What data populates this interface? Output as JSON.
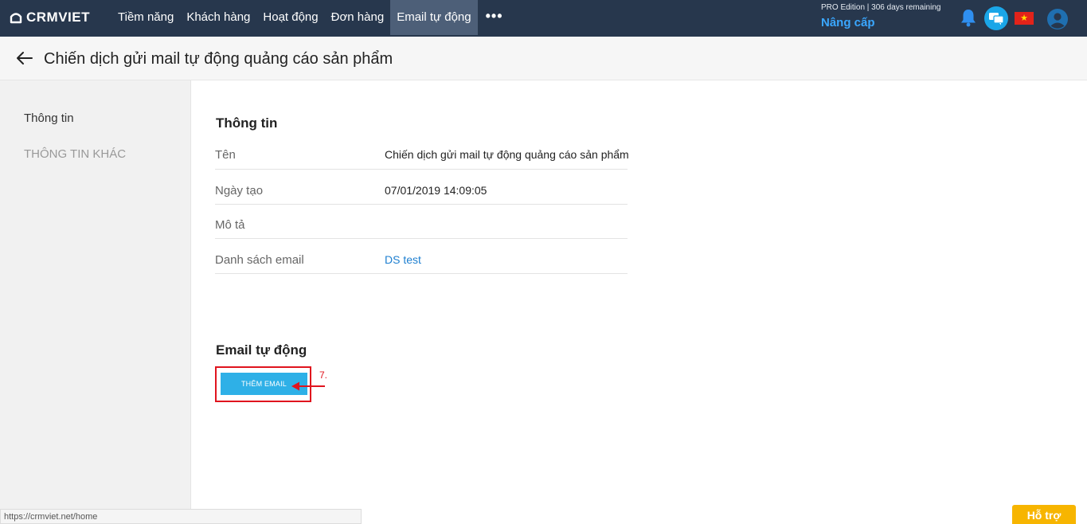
{
  "app": {
    "logo_text": "CRMVIET"
  },
  "nav": {
    "items": [
      {
        "label": "Tiềm năng"
      },
      {
        "label": "Khách hàng"
      },
      {
        "label": "Hoạt động"
      },
      {
        "label": "Đơn hàng"
      },
      {
        "label": "Email tự động",
        "active": true
      }
    ],
    "more_label": "•••"
  },
  "account": {
    "edition_text": "PRO Edition | 306 days remaining",
    "upgrade_label": "Nâng cấp",
    "flag_star": "★"
  },
  "header": {
    "title": "Chiến dịch gửi mail tự động quảng cáo sản phẩm"
  },
  "sidebar": {
    "items": [
      {
        "label": "Thông tin"
      },
      {
        "label": "THÔNG TIN KHÁC"
      }
    ]
  },
  "info": {
    "title": "Thông tin",
    "rows": [
      {
        "label": "Tên",
        "value": "Chiến dịch gửi mail tự động quảng cáo sản phẩm"
      },
      {
        "label": "Ngày tạo",
        "value": "07/01/2019 14:09:05"
      },
      {
        "label": "Mô tả",
        "value": ""
      },
      {
        "label": "Danh sách email",
        "value": "DS test"
      }
    ]
  },
  "auto_email": {
    "title": "Email tự động",
    "add_button_label": "THÊM EMAIL",
    "step_annotation": "7."
  },
  "status_bar": {
    "url": "https://crmviet.net/home"
  },
  "support": {
    "label": "Hỗ trợ"
  },
  "colors": {
    "topbar": "#27374d",
    "nav_active": "#4d5f78",
    "upgrade_link": "#3aa7ff",
    "primary_button": "#2eb0e7",
    "annotation_red": "#e0141e",
    "support_button": "#f7b500",
    "link": "#1e7fd0"
  }
}
